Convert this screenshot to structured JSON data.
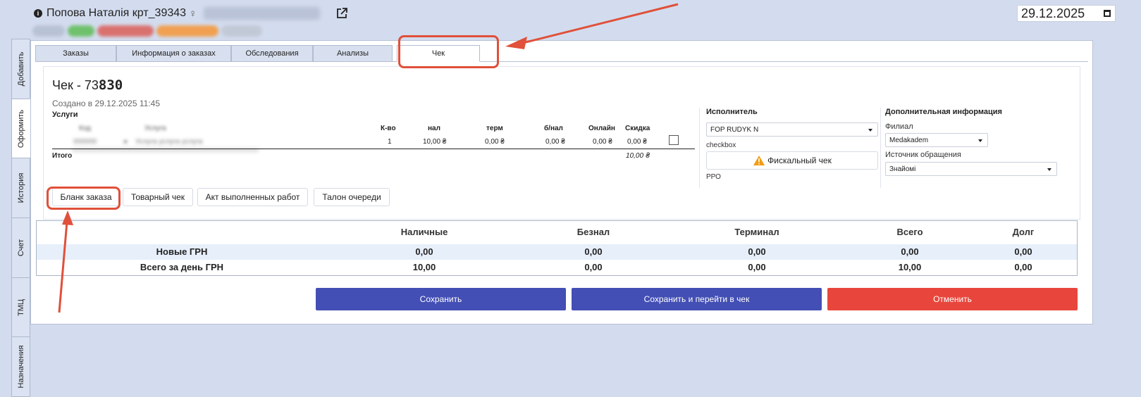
{
  "patient": {
    "name": "Попова Наталія крт_39343",
    "gender_symbol": "♀"
  },
  "date": "29.12.2025",
  "side_tabs": [
    "Добавить",
    "Оформить",
    "История",
    "Счет",
    "ТМЦ",
    "Назначения"
  ],
  "top_tabs": [
    "Заказы",
    "Информация о заказах",
    "Обследования",
    "Анализы",
    "Чек"
  ],
  "check": {
    "title_prefix": "Чек - 73",
    "title_suffix": "830",
    "created": "Создано в 29.12.2025 11:45",
    "services_label": "Услуги",
    "columns": [
      "К-во",
      "нал",
      "терм",
      "б/нал",
      "Онлайн",
      "Скидка"
    ],
    "row": {
      "qty": "1",
      "cash": "10,00 ₴",
      "term": "0,00 ₴",
      "noncash": "0,00 ₴",
      "online": "0,00 ₴",
      "discount": "0,00 ₴"
    },
    "total_label": "Итого",
    "total_value": "10,00 ₴"
  },
  "print_buttons": [
    "Бланк заказа",
    "Товарный чек",
    "Акт выполненных работ",
    "Талон очереди"
  ],
  "executor": {
    "title": "Исполнитель",
    "selected": "FOP RUDYK N",
    "sub_label": "checkbox",
    "fiscal_button": "Фискальный чек",
    "rro_label": "РРО"
  },
  "additional_info": {
    "title": "Дополнительная информация",
    "branch_label": "Филиал",
    "branch_value": "Medakadem",
    "source_label": "Источник обращения",
    "source_value": "Знайомі"
  },
  "totals": {
    "headers": [
      "Наличные",
      "Безнал",
      "Терминал",
      "Всего",
      "Долг"
    ],
    "rows": [
      {
        "label": "Новые ГРН",
        "values": [
          "0,00",
          "0,00",
          "0,00",
          "0,00",
          "0,00"
        ]
      },
      {
        "label": "Всего за день ГРН",
        "values": [
          "10,00",
          "0,00",
          "0,00",
          "10,00",
          "0,00"
        ]
      }
    ]
  },
  "actions": {
    "save": "Сохранить",
    "save_and_go": "Сохранить и перейти в чек",
    "cancel": "Отменить"
  },
  "colors": {
    "accent_blue": "#434fb4",
    "danger_red": "#e8463c",
    "annotation_red": "#e0503a",
    "page_bg": "#d3dcee"
  }
}
